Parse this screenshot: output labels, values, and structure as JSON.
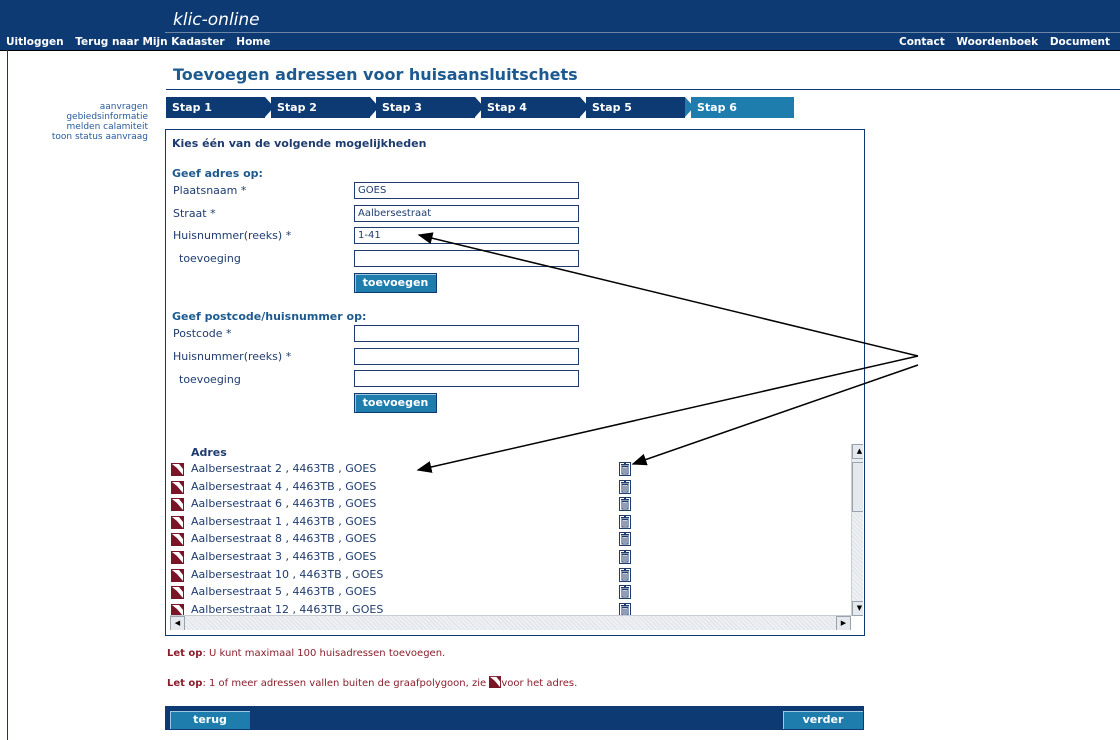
{
  "header": {
    "brand": "klic-online",
    "nav_left": [
      "Uitloggen",
      "Terug naar Mijn Kadaster",
      "Home"
    ],
    "nav_right": [
      "Contact",
      "Woordenboek",
      "Document"
    ]
  },
  "sidebar": {
    "links": [
      "aanvragen",
      "gebiedsinformatie",
      "melden calamiteit",
      "toon status aanvraag"
    ]
  },
  "page": {
    "title": "Toevoegen adressen voor huisaansluitschets"
  },
  "steps": [
    "Stap 1",
    "Stap 2",
    "Stap 3",
    "Stap 4",
    "Stap 5",
    "Stap 6"
  ],
  "form": {
    "heading": "Kies één van de volgende mogelijkheden",
    "address_section": {
      "title": "Geef adres op:",
      "plaatsnaam_label": "Plaatsnaam *",
      "plaatsnaam_value": "GOES",
      "straat_label": "Straat *",
      "straat_value": "Aalbersestraat",
      "huisnummer_label": "Huisnummer(reeks) *",
      "huisnummer_value": "1-41",
      "toevoeging_label": "toevoeging",
      "toevoeging_value": "",
      "add_button": "toevoegen"
    },
    "postcode_section": {
      "title": "Geef postcode/huisnummer op:",
      "postcode_label": "Postcode *",
      "postcode_value": "",
      "huisnummer_label": "Huisnummer(reeks) *",
      "huisnummer_value": "",
      "toevoeging_label": "toevoeging",
      "toevoeging_value": "",
      "add_button": "toevoegen"
    }
  },
  "address_list": {
    "header": "Adres",
    "items": [
      "Aalbersestraat 2 , 4463TB , GOES",
      "Aalbersestraat 4 , 4463TB , GOES",
      "Aalbersestraat 6 , 4463TB , GOES",
      "Aalbersestraat 1 , 4463TB , GOES",
      "Aalbersestraat 8 , 4463TB , GOES",
      "Aalbersestraat 3 , 4463TB , GOES",
      "Aalbersestraat 10 , 4463TB , GOES",
      "Aalbersestraat 5 , 4463TB , GOES",
      "Aalbersestraat 12 , 4463TB , GOES"
    ]
  },
  "notes": {
    "note1_prefix": "Let op",
    "note1_text": ": U kunt maximaal 100 huisadressen toevoegen.",
    "note2_prefix": "Let op",
    "note2_text": ": 1 of meer adressen vallen buiten de graafpolygoon, zie ",
    "note2_suffix": "voor het adres."
  },
  "footer": {
    "back_button": "terug",
    "next_button": "verder"
  },
  "colors": {
    "navy": "#0e3a73",
    "accent": "#1f7dae",
    "warning": "#8a1f2b"
  },
  "icons": {
    "outside_polygon": "polygon-warning-icon",
    "delete": "trash-icon"
  }
}
